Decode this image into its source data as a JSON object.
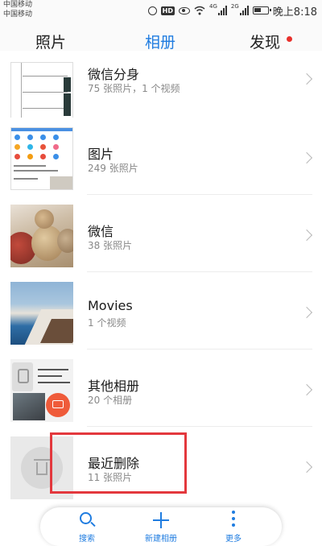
{
  "status_bar": {
    "carrier_1": "中国移动",
    "carrier_2": "中国移动",
    "hd_badge": "HD",
    "signal_label_1": "4G",
    "signal_label_2": "2G",
    "time": "晚上8:18",
    "icons": [
      "alarm-icon",
      "hd-icon",
      "eye-icon",
      "wifi-icon",
      "signal-icon",
      "signal-icon",
      "battery-icon"
    ]
  },
  "tabs": [
    {
      "label": "照片",
      "active": false
    },
    {
      "label": "相册",
      "active": true
    },
    {
      "label": "发现",
      "active": false,
      "badge_dot": true
    }
  ],
  "colors": {
    "accent": "#1f7ce0",
    "badge": "#e8302b",
    "highlight": "#e3383d"
  },
  "albums": [
    {
      "title": "微信分身",
      "subtitle": "75 张照片，1 个视频"
    },
    {
      "title": "图片",
      "subtitle": "249 张照片"
    },
    {
      "title": "微信",
      "subtitle": "38 张照片"
    },
    {
      "title": "Movies",
      "subtitle": "1 个视频"
    },
    {
      "title": "其他相册",
      "subtitle": "20 个相册"
    },
    {
      "title": "最近删除",
      "subtitle": "11 张照片"
    }
  ],
  "bottom_bar": [
    {
      "label": "搜索",
      "icon": "search-icon"
    },
    {
      "label": "新建相册",
      "icon": "plus-icon"
    },
    {
      "label": "更多",
      "icon": "more-icon"
    }
  ]
}
